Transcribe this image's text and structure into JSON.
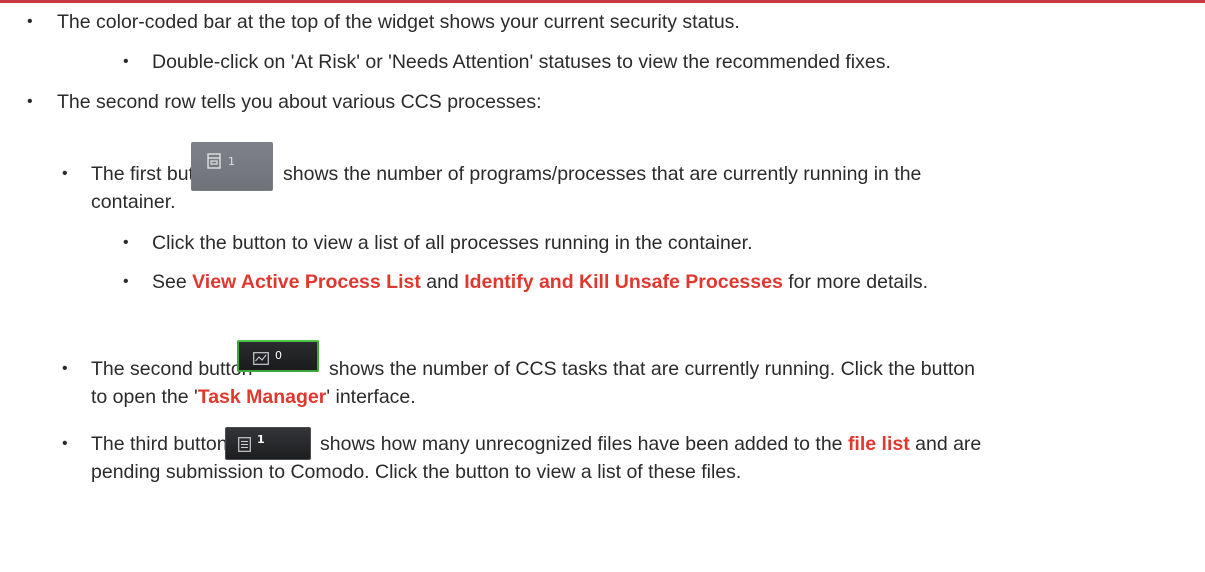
{
  "bullets": {
    "b1": "The color-coded bar at the top of the widget shows your current security status.",
    "b1a": "Double-click on 'At Risk' or 'Needs Attention' statuses to view the recommended fixes.",
    "b2": "The second row tells you about various CCS processes:",
    "b3_pre": "The first button",
    "b3_post": "shows the number of programs/processes that are currently running in the",
    "b3_cont": "container.",
    "b3a": "Click the button to view a list of all processes running in the container.",
    "b3b_pre": "See ",
    "b3b_link1": "View Active Process List",
    "b3b_mid": " and ",
    "b3b_link2": "Identify and Kill Unsafe Processes",
    "b3b_post": " for more details.",
    "b4_pre": "The second button",
    "b4_post": "shows the number of CCS tasks that are currently running. Click the button",
    "b4_cont_pre": "to open the '",
    "b4_cont_link": "Task Manager",
    "b4_cont_post": "' interface.",
    "b5_pre": "The third button",
    "b5_post_pre": "shows how many unrecognized files have been added to the ",
    "b5_link": "file list",
    "b5_post_post": " and are",
    "b5_cont": "pending submission to Comodo. Click the button to view a list of these files."
  },
  "buttons": {
    "container_count": "1",
    "tasks_count": "0",
    "files_count": "1",
    "container_icon": "container-box-icon",
    "tasks_icon": "task-chart-icon",
    "files_icon": "file-list-icon"
  },
  "colors": {
    "link": "#e0382f",
    "text": "#2b2b2b",
    "top_rule": "#c7383f",
    "green_border": "#3fa63b"
  }
}
